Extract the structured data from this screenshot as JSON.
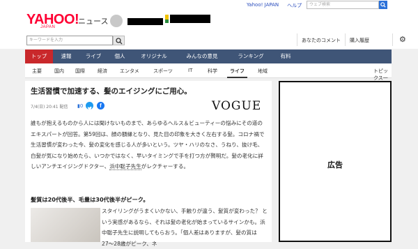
{
  "header": {
    "logo_text": "YAHOO!",
    "logo_sub": "JAPAN",
    "service_name": "ニュース",
    "top_links": [
      "Yahoo! JAPAN",
      "ヘルプ"
    ],
    "web_search_placeholder": "ウェブ検索"
  },
  "searchbar": {
    "placeholder": "キーワードを入力",
    "links": [
      "あなたのコメント",
      "購入履歴"
    ],
    "icons": {
      "search": "search-icon",
      "settings": "gear-icon"
    }
  },
  "categories": {
    "items": [
      "トップ",
      "速報",
      "ライブ",
      "個人",
      "オリジナル",
      "みんなの意見",
      "ランキング",
      "有料"
    ],
    "active": "トップ",
    "bg_color": "#3f5577",
    "active_color": "#c9282b"
  },
  "subnav": {
    "items": [
      "主要",
      "国内",
      "国際",
      "経済",
      "エンタメ",
      "スポーツ",
      "IT",
      "科学",
      "ライフ",
      "地域"
    ],
    "active": "ライフ",
    "topics_label": "トピックス一覧"
  },
  "article": {
    "title": "生活習慣で加速する、髪のエイジングにご用心。",
    "meta": "7/4(日) 20:41 配信",
    "comment_count": "0",
    "source_logo": "VOGUE",
    "body_prefix": "誰もが抱えるものから人には聞けないものまで、あらゆるヘルス＆ビューティーの悩みにその道のエキスパートが回答。第59回は、顔の額縁となり、見た目の印象を大きく左右する髪。コロナ禍で生活習慣が変わった今、髪の変化を感じる人が多いという。ツヤ・ハリのなさ、うねり、抜け毛、白髪が気になり始めたら、いつかではなく、早いタイミングで手を打つ方が賢明だ。髪の老化に詳しいアンチエイジングドクター、",
    "body_link": "浜中聡子先生",
    "body_suffix": "がレクチャーする。",
    "subheading": "髪質は20代後半、毛量は30代後半がピーク。",
    "body2": "スタイリングがうまくいかない、手触りが違う、髪質が変わった？ という実感があるなら、それは髪の老化が始まっているサインかも。浜中聡子先生に説明してもらおう。「個人差はありますが、髪の質は27〜28歳がピーク、ネ"
  },
  "ad": {
    "label": "広告"
  }
}
